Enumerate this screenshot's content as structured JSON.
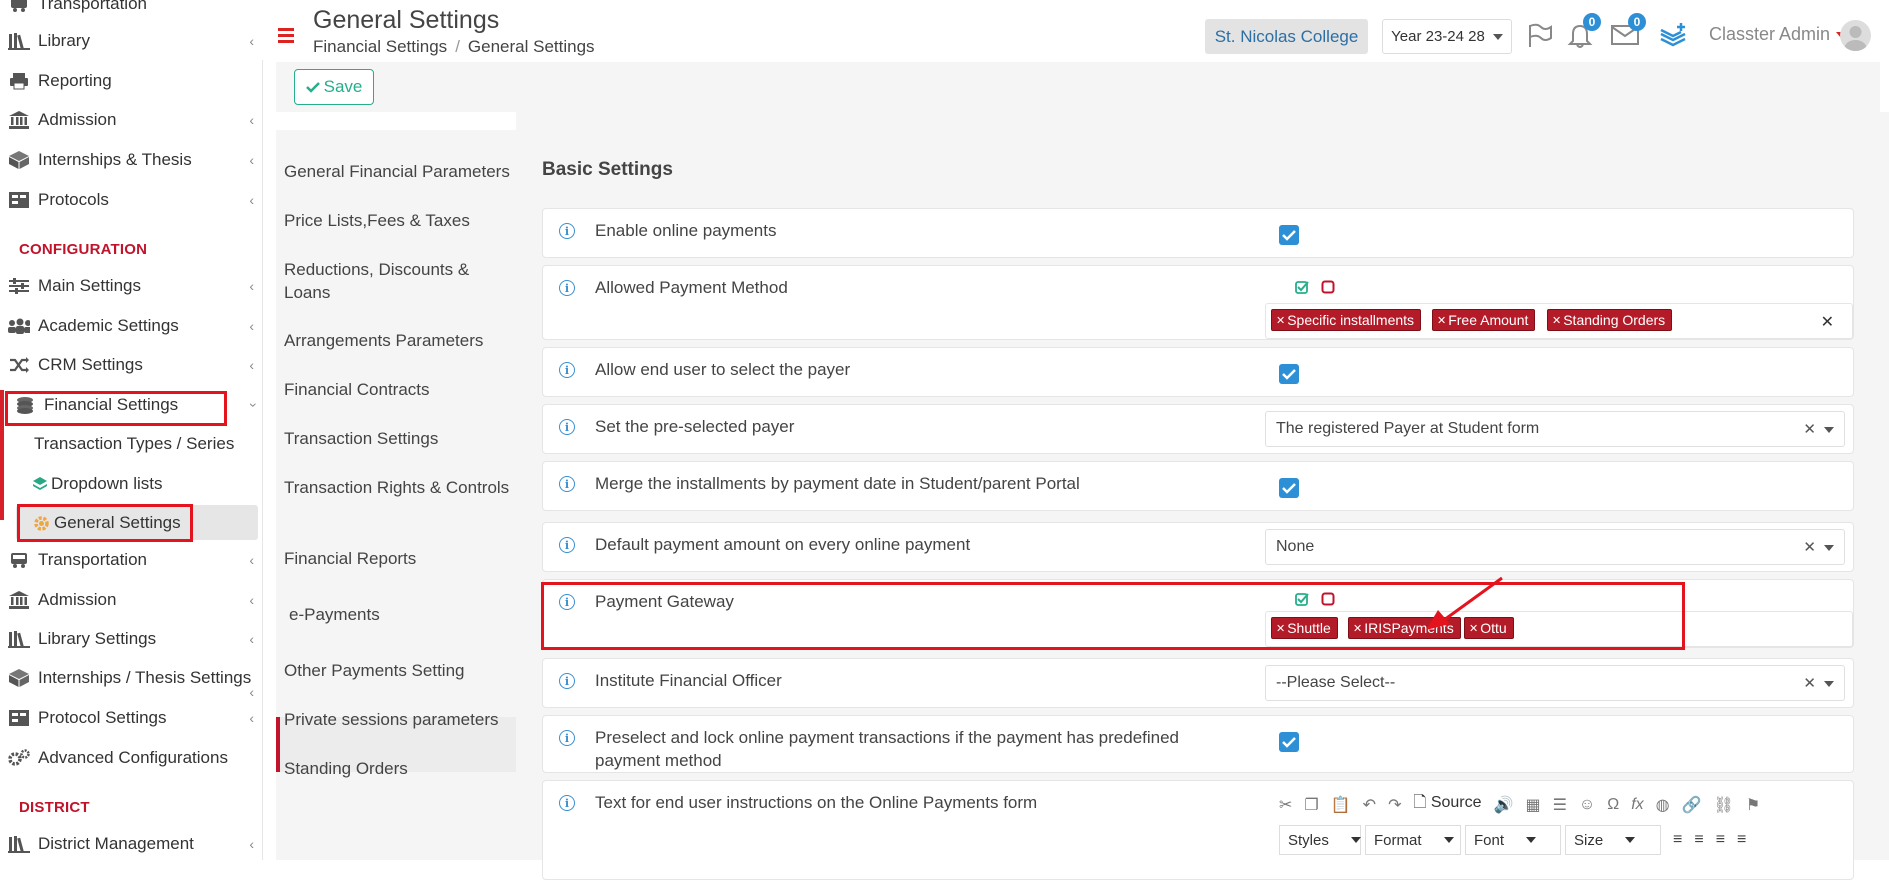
{
  "sidebar": {
    "items": [
      {
        "label": "Transportation",
        "icon": "bus-icon"
      },
      {
        "label": "Library",
        "icon": "books-icon"
      },
      {
        "label": "Reporting",
        "icon": "printer-icon"
      },
      {
        "label": "Admission",
        "icon": "institution-icon"
      },
      {
        "label": "Internships & Thesis",
        "icon": "box-icon"
      },
      {
        "label": "Protocols",
        "icon": "archive-icon"
      }
    ],
    "section_configuration": "CONFIGURATION",
    "config_items": [
      {
        "label": "Main Settings",
        "icon": "sliders-icon"
      },
      {
        "label": "Academic Settings",
        "icon": "users-icon"
      },
      {
        "label": "CRM Settings",
        "icon": "shuffle-icon"
      },
      {
        "label": "Financial Settings",
        "icon": "coins-icon"
      }
    ],
    "financial_sub": [
      {
        "label": "Transaction Types / Series"
      },
      {
        "label": "Dropdown lists",
        "icon": "layers-icon"
      },
      {
        "label": "General Settings",
        "icon": "cog-icon"
      }
    ],
    "config_items2": [
      {
        "label": "Transportation",
        "icon": "bus-icon"
      },
      {
        "label": "Admission",
        "icon": "institution-icon"
      },
      {
        "label": "Library Settings",
        "icon": "books-icon"
      },
      {
        "label": "Internships / Thesis Settings",
        "icon": "box-icon"
      },
      {
        "label": "Protocol Settings",
        "icon": "archive-icon"
      },
      {
        "label": "Advanced Configurations",
        "icon": "cogs-icon"
      }
    ],
    "section_district": "DISTRICT",
    "district_items": [
      {
        "label": "District Management",
        "icon": "district-icon"
      }
    ]
  },
  "header": {
    "title": "General Settings",
    "breadcrumb": [
      "Financial Settings",
      "General Settings"
    ],
    "college": "St. Nicolas College",
    "year": "Year 23-24 28",
    "notifications_count": "0",
    "messages_count": "0",
    "user": "Classter Admin"
  },
  "toolbar": {
    "save_label": "Save"
  },
  "settings_nav": [
    "General Financial Parameters",
    "Price Lists,Fees & Taxes",
    "Reductions, Discounts & Loans",
    "Arrangements Parameters",
    "Financial Contracts",
    "Transaction Settings",
    "Transaction Rights & Controls",
    "Financial Reports",
    "e-Payments",
    "Other Payments Setting",
    "Private sessions parameters",
    "Standing Orders"
  ],
  "main": {
    "section_title": "Basic Settings",
    "rows": [
      {
        "label": "Enable online payments",
        "type": "checkbox",
        "checked": true
      },
      {
        "label": "Allowed Payment Method",
        "type": "tags",
        "tags": [
          "Specific installments",
          "Free Amount",
          "Standing Orders"
        ]
      },
      {
        "label": "Allow end user to select the payer",
        "type": "checkbox",
        "checked": true
      },
      {
        "label": "Set the pre-selected payer",
        "type": "select",
        "value": "The registered Payer at Student form"
      },
      {
        "label": "Merge the installments by payment date in Student/parent Portal",
        "type": "checkbox",
        "checked": true
      },
      {
        "label": "Default payment amount on every online payment",
        "type": "select",
        "value": "None"
      },
      {
        "label": "Payment Gateway",
        "type": "tags",
        "tags": [
          "Shuttle",
          "IRISPayments",
          "Ottu"
        ]
      },
      {
        "label": "Institute Financial Officer",
        "type": "select",
        "value": "--Please Select--"
      },
      {
        "label": "Preselect and lock online payment transactions if the payment has predefined payment method",
        "type": "checkbox",
        "checked": true
      },
      {
        "label": "Text for end user instructions on the Online Payments form",
        "type": "editor"
      }
    ],
    "editor": {
      "source_label": "Source",
      "styles": "Styles",
      "format": "Format",
      "font": "Font",
      "size": "Size"
    }
  },
  "colors": {
    "accent_red": "#c0132c",
    "tag_red": "#b31b28",
    "primary_blue": "#2d8fd6",
    "save_green": "#27ae8a",
    "highlight": "#e3141e"
  }
}
